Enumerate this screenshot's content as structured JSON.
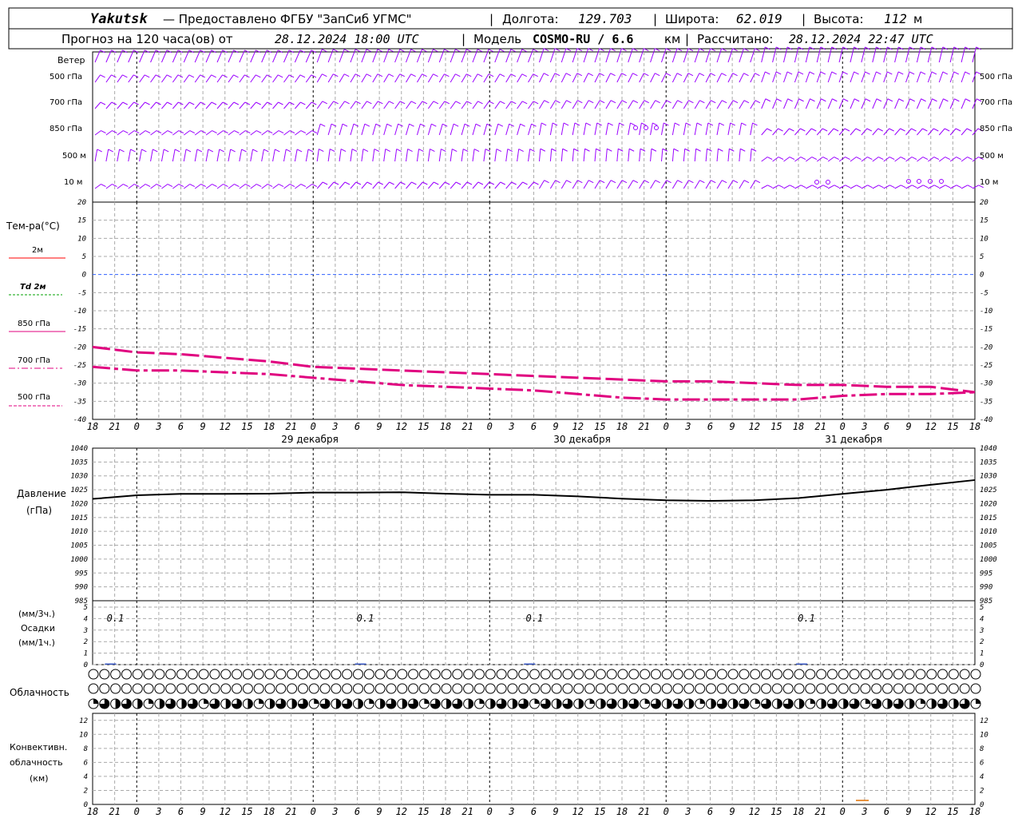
{
  "header": {
    "station": "Yakutsk",
    "provider": "— Предоставлено ФГБУ \"ЗапСиб УГМС\"",
    "lon_label": "Долгота:",
    "lon_value": "129.703",
    "lat_label": "Широта:",
    "lat_value": "62.019",
    "alt_label": "Высота:",
    "alt_value": "112",
    "alt_unit": "м",
    "forecast_label": "Прогноз на 120 часа(ов) от",
    "forecast_start": "28.12.2024 18:00 UTC",
    "model_label": "Модель",
    "model_name": "COSMO-RU / 6.6",
    "model_unit": "км",
    "computed_label": "Рассчитано:",
    "computed_value": "28.12.2024 22:47 UTC"
  },
  "wind_panel": {
    "labels": [
      "Ветер",
      "500 гПа",
      "700 гПа",
      "850 гПа",
      "500 м",
      "10 м"
    ],
    "right_labels": [
      "500 гПа",
      "700 гПа",
      "850 гПа",
      "500 м",
      "10 м"
    ],
    "barb_color": "#9a00ff"
  },
  "temp_panel": {
    "title": "Тем-ра(°C)",
    "legend": [
      {
        "label": "2м",
        "color": "#ff0000",
        "style": "solid"
      },
      {
        "label": "Td 2м",
        "color": "#00a000",
        "style": "dashed"
      },
      {
        "label": "850 гПа",
        "color": "#e0007f",
        "style": "solid"
      },
      {
        "label": "700 гПа",
        "color": "#e0007f",
        "style": "dash-dot"
      },
      {
        "label": "500 гПа",
        "color": "#e0007f",
        "style": "dashed"
      }
    ]
  },
  "time_axis": {
    "hour_ticks": [
      "18",
      "21",
      "0",
      "3",
      "6",
      "9",
      "12",
      "15",
      "18",
      "21",
      "0",
      "3",
      "6",
      "9",
      "12",
      "15",
      "18",
      "21",
      "0",
      "3",
      "6",
      "9",
      "12",
      "15",
      "18",
      "21",
      "0"
    ],
    "dates": [
      "29 декабря",
      "30 декабря",
      "31 декабря"
    ]
  },
  "pressure_panel": {
    "title": "Давление",
    "unit": "(гПа)"
  },
  "precip_panel": {
    "left_unit_top": "(мм/3ч.)",
    "title": "Осадки",
    "left_unit_bottom": "(мм/1ч.)",
    "annotations": [
      "0.1",
      "0.1",
      "0.1",
      "0.1"
    ]
  },
  "cloud_panel": {
    "title": "Облачность"
  },
  "conv_panel": {
    "title_lines": [
      "Конвективн.",
      "облачность",
      "(км)"
    ]
  },
  "chart_data": [
    {
      "type": "line",
      "panel": "temperature",
      "ylim": [
        -40,
        20
      ],
      "yticks": [
        -40,
        -35,
        -30,
        -25,
        -20,
        -15,
        -10,
        -5,
        0,
        5,
        10,
        15,
        20
      ],
      "x_hours_from_start": [
        0,
        6,
        12,
        18,
        24,
        30,
        36,
        42,
        48,
        54,
        60,
        66,
        72,
        78,
        84,
        90,
        96,
        102,
        108,
        114,
        120
      ],
      "series": [
        {
          "name": "700 гПа",
          "color": "#e0007f",
          "style": "dash-dot",
          "values": [
            -25.5,
            -26.5,
            -26.5,
            -27,
            -27.5,
            -28.5,
            -29.5,
            -30.5,
            -31,
            -31.5,
            -32,
            -33,
            -34,
            -34.5,
            -34.5,
            -34.5,
            -34.5,
            -33.5,
            -33,
            -33,
            -32.5
          ]
        },
        {
          "name": "500 гПа",
          "color": "#e0007f",
          "style": "dashed",
          "values": [
            -20,
            -21.5,
            -22,
            -23,
            -24,
            -25.5,
            -26,
            -26.5,
            -27,
            -27.5,
            -28,
            -28.5,
            -29,
            -29.5,
            -29.5,
            -30,
            -30.5,
            -30.5,
            -31,
            -31,
            -32.5
          ]
        }
      ]
    },
    {
      "type": "line",
      "panel": "pressure",
      "ylim": [
        985,
        1040
      ],
      "yticks": [
        985,
        990,
        995,
        1000,
        1005,
        1010,
        1015,
        1020,
        1025,
        1030,
        1035,
        1040
      ],
      "x_hours_from_start": [
        0,
        6,
        12,
        18,
        24,
        30,
        36,
        42,
        48,
        54,
        60,
        66,
        72,
        78,
        84,
        90,
        96,
        102,
        108,
        114,
        120
      ],
      "series": [
        {
          "name": "Давление",
          "color": "#000000",
          "values": [
            1021.7,
            1023.0,
            1023.5,
            1023.5,
            1023.6,
            1024.0,
            1024.0,
            1024.1,
            1023.6,
            1023.2,
            1023.2,
            1022.6,
            1021.8,
            1021.2,
            1021.0,
            1021.2,
            1022.0,
            1023.5,
            1025.0,
            1026.8,
            1028.5
          ]
        }
      ]
    },
    {
      "type": "bar",
      "panel": "precipitation",
      "ylim": [
        0,
        5
      ],
      "yticks": [
        0,
        1,
        2,
        3,
        4,
        5
      ],
      "values_mm": [
        0.1,
        0.1,
        0.1,
        0.1
      ],
      "x_hours_from_start": [
        2,
        36,
        59,
        96
      ]
    },
    {
      "type": "bar",
      "panel": "convective_cloud",
      "ylim": [
        0,
        13
      ],
      "yticks": [
        0,
        2,
        4,
        6,
        8,
        10,
        12
      ]
    }
  ]
}
